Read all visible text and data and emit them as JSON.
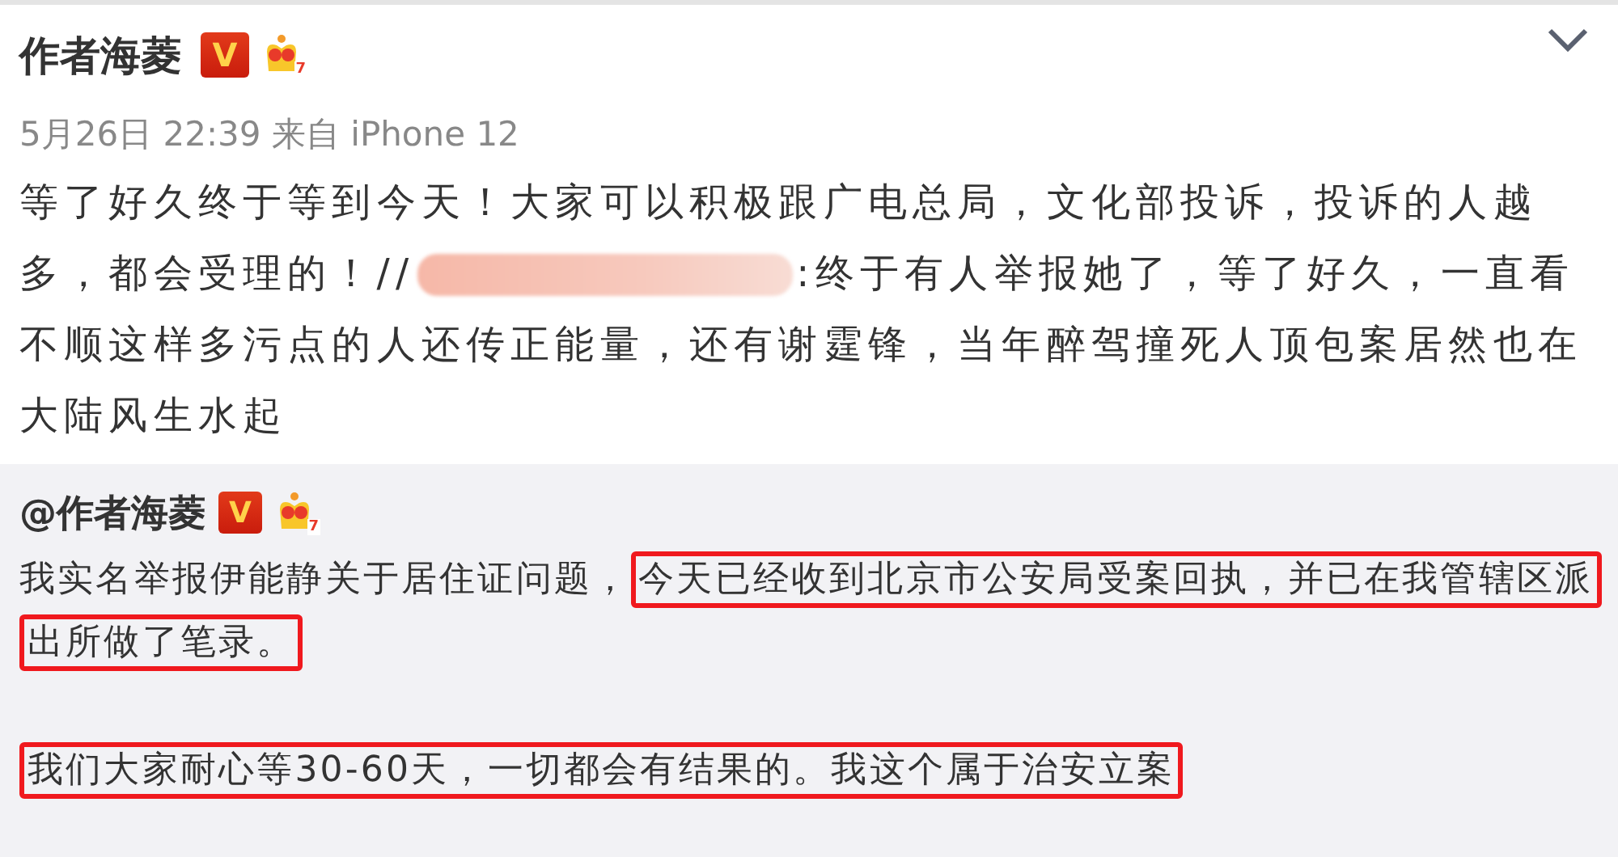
{
  "post": {
    "author": "作者海菱",
    "badge": "V",
    "vip_level": "7",
    "time": "5月26日 22:39 来自 iPhone 12",
    "text_before": "等了好久终于等到今天！大家可以积极跟广电总局，文化部投诉，投诉的人越多，都会受理的！//",
    "text_after": ":终于有人举报她了，等了好久，一直看不顺这样多污点的人还传正能量，还有谢霆锋，当年醉驾撞死人顶包案居然也在大陆风生水起"
  },
  "repost": {
    "author": "@作者海菱",
    "badge": "V",
    "vip_level": "7",
    "paragraphs": [
      {
        "segments": [
          {
            "text": "我实名举报伊能静关于居住证问题，",
            "highlighted": false
          },
          {
            "text": "今天已经收到北京市公安局受案回执，并已在我管辖区派出所做了笔录。",
            "highlighted": true
          }
        ]
      },
      {
        "segments": [
          {
            "text": "我们大家耐心等30-60天，一切都会有结果的。我这个属于治安立案",
            "highlighted": true
          }
        ]
      }
    ]
  }
}
